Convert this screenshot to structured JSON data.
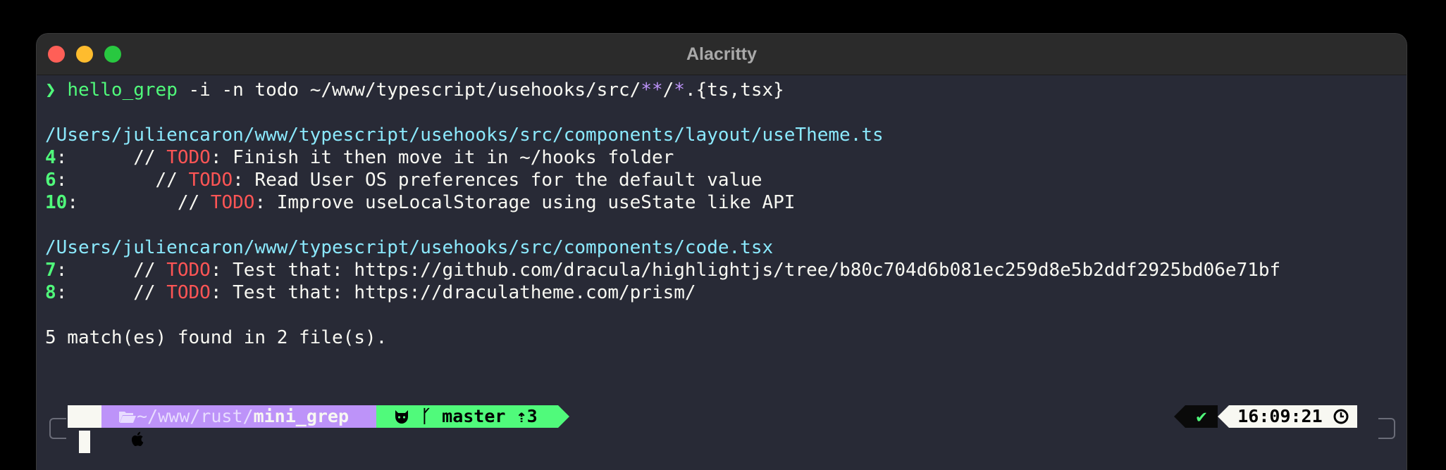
{
  "window": {
    "title": "Alacritty"
  },
  "command": {
    "prompt_glyph": "❯",
    "program": "hello_grep",
    "args_pre": " -i -n todo ~/www/typescript/usehooks/src/",
    "glob1": "**",
    "slash": "/",
    "glob2": "*",
    "args_post": ".{ts,tsx}"
  },
  "results": [
    {
      "file": "/Users/juliencaron/www/typescript/usehooks/src/components/layout/useTheme.ts",
      "matches": [
        {
          "line": "4",
          "sep": ":",
          "indent": "      // ",
          "tag": "TODO",
          "text": ": Finish it then move it in ~/hooks folder"
        },
        {
          "line": "6",
          "sep": ":",
          "indent": "        // ",
          "tag": "TODO",
          "text": ": Read User OS preferences for the default value"
        },
        {
          "line": "10",
          "sep": ":",
          "indent": "         // ",
          "tag": "TODO",
          "text": ": Improve useLocalStorage using useState like API"
        }
      ]
    },
    {
      "file": "/Users/juliencaron/www/typescript/usehooks/src/components/code.tsx",
      "matches": [
        {
          "line": "7",
          "sep": ":",
          "indent": "      // ",
          "tag": "TODO",
          "text": ": Test that: https://github.com/dracula/highlightjs/tree/b80c704d6b081ec259d8e5b2ddf2925bd06e71bf"
        },
        {
          "line": "8",
          "sep": ":",
          "indent": "      // ",
          "tag": "TODO",
          "text": ": Test that: https://draculatheme.com/prism/"
        }
      ]
    }
  ],
  "summary": "5 match(es) found in 2 file(s).",
  "prompt": {
    "path_prefix": "~/www/rust/",
    "path_dir": "mini_grep",
    "branch_glyph": "ᚴ",
    "branch": "master",
    "ahead": "⇡3",
    "status_glyph": "✔",
    "time": "16:09:21"
  },
  "icons": {
    "apple": "apple-icon",
    "folder": "folder-open-icon",
    "github": "github-icon",
    "branch": "git-branch-icon",
    "clock": "clock-icon"
  },
  "colors": {
    "background": "#282a36",
    "foreground": "#f8f8f2",
    "green": "#50fa7b",
    "purple": "#bd93f9",
    "cyan": "#8be9fd",
    "red": "#ff5555"
  }
}
